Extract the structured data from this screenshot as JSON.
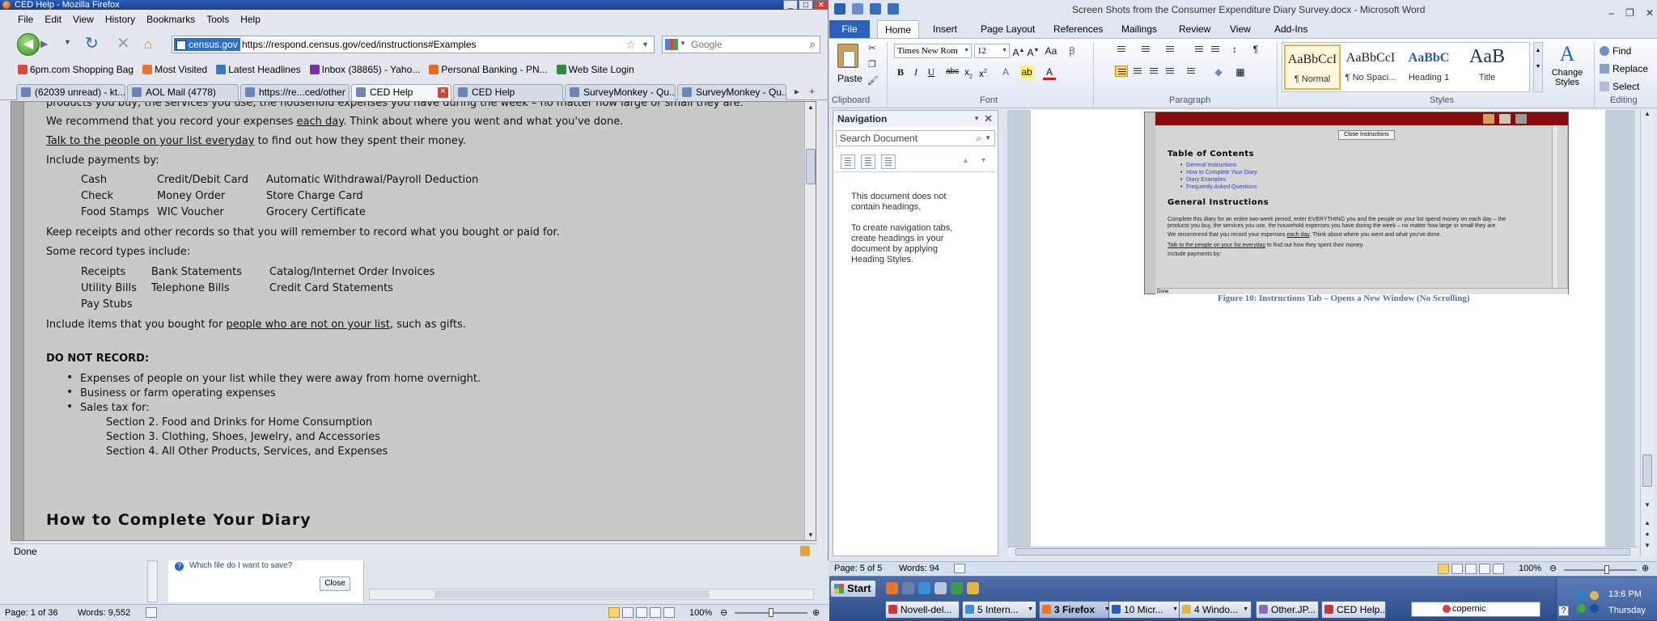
{
  "firefox": {
    "title": "CED Help - Mozilla Firefox",
    "menu": [
      "File",
      "Edit",
      "View",
      "History",
      "Bookmarks",
      "Tools",
      "Help"
    ],
    "url_site": "census.gov",
    "url": "https://respond.census.gov/ced/instructions#Examples",
    "search_placeholder": "Google",
    "bookmarks": [
      "6pm.com Shopping Bag",
      "Most Visited",
      "Latest Headlines",
      "Inbox (38865) - Yaho...",
      "Personal Banking - PN...",
      "Web Site Login"
    ],
    "tabs": [
      "(62039 unread) - kt...",
      "AOL Mail (4778)",
      "https://re...ced/other",
      "CED Help",
      "CED Help",
      "SurveyMonkey - Qu...",
      "SurveyMonkey - Qu..."
    ],
    "status": "Done",
    "content": {
      "cut_line": "products you buy, the services you use, the household expenses you have during the week – no matter how large or small they are.",
      "recommend_a": "We recommend that you record your expenses ",
      "recommend_u": "each day",
      "recommend_b": ". Think about where you went and what you've done.",
      "talk_u": "Talk to the people on your list everyday",
      "talk_b": " to find out how they spent their money.",
      "include_payments": "Include payments by:",
      "payments": [
        [
          "Cash",
          "Credit/Debit Card",
          "Automatic Withdrawal/Payroll Deduction"
        ],
        [
          "Check",
          "Money Order",
          "Store Charge Card"
        ],
        [
          "Food Stamps",
          "WIC Voucher",
          "Grocery Certificate"
        ]
      ],
      "keep_receipts": "Keep receipts and other records so that you will remember to record what you bought or paid for.",
      "record_types_intro": "Some record types include:",
      "record_types": [
        [
          "Receipts",
          "Bank Statements",
          "Catalog/Internet Order Invoices"
        ],
        [
          "Utility Bills",
          "Telephone Bills",
          "Credit Card Statements"
        ],
        [
          "Pay Stubs",
          "",
          ""
        ]
      ],
      "include_items_a": "Include items that you bought for ",
      "include_items_u": "people who are not on your list",
      "include_items_b": ", such as gifts.",
      "do_not_record": "DO NOT RECORD:",
      "bullets": [
        "Expenses of people on your list while they were away from home overnight.",
        "Business or farm operating expenses",
        "Sales tax for:"
      ],
      "sections": [
        "Section 2. Food and Drinks for Home Consumption",
        "Section 3. Clothing, Shoes, Jewelry, and Accessories",
        "Section 4. All Other Products, Services, and Expenses"
      ],
      "next_heading": "How to Complete Your Diary"
    }
  },
  "word_left": {
    "hint": "Which file do I want to save?",
    "close_label": "Close",
    "page": "Page: 1 of 36",
    "words": "Words: 9,552",
    "zoom": "100%"
  },
  "word": {
    "title": "Screen Shots from the Consumer Expenditure Diary Survey.docx - Microsoft Word",
    "file_tab": "File",
    "ribbon_tabs": [
      "Home",
      "Insert",
      "Page Layout",
      "References",
      "Mailings",
      "Review",
      "View",
      "Add-Ins"
    ],
    "paste_label": "Paste",
    "font_name": "Times New Rom",
    "font_size": "12",
    "group_labels": [
      "Clipboard",
      "Font",
      "Paragraph",
      "Styles",
      "Editing"
    ],
    "styles": [
      {
        "preview": "AaBbCcI",
        "name": "¶ Normal"
      },
      {
        "preview": "AaBbCcI",
        "name": "¶ No Spaci..."
      },
      {
        "preview": "AaBbC",
        "name": "Heading 1"
      },
      {
        "preview": "AaB",
        "name": "Title"
      }
    ],
    "change_styles": "Change Styles",
    "editing": [
      "Find",
      "Replace",
      "Select"
    ],
    "nav": {
      "title": "Navigation",
      "search_placeholder": "Search Document",
      "msg1": "This document does not contain headings.",
      "msg2": "To create navigation tabs, create headings in your document by applying Heading Styles."
    },
    "shot": {
      "close_btn": "Close Instructions",
      "toc_title": "Table of Contents",
      "toc": [
        "General Instructions",
        "How to Complete Your Diary",
        "Diary Examples",
        "Frequently Asked Questions"
      ],
      "gen_title": "General Instructions",
      "lines": [
        "Complete this diary for an entire two-week period, enter EVERYTHING you and the people on your list spend money on each day – the",
        "products you buy, the services you use, the household expenses you have during the week – no matter how large or small they are."
      ],
      "rec_a": "We recommend that you record your expenses ",
      "rec_u": "each day",
      "rec_b": ". Think about where you went and what you've done.",
      "talk_u": "Talk to the people on your list everyday",
      "talk_b": " to find out how they spent their money.",
      "include": "Include payments by:",
      "status": "Done"
    },
    "caption": "Figure 10: Instructions Tab – Opens a New Window (No Scrolling)",
    "status_page": "Page: 5 of 5",
    "status_words": "Words: 94",
    "zoom": "100%"
  },
  "taskbar": {
    "start": "Start",
    "buttons": [
      "Novell-del...",
      "5 Intern...",
      "3 Firefox",
      "10 Micr...",
      "4 Windo...",
      "Other.JP...",
      "CED Help...."
    ],
    "search_value": "copernic",
    "time": "13:6 PM",
    "day": "Thursday"
  }
}
